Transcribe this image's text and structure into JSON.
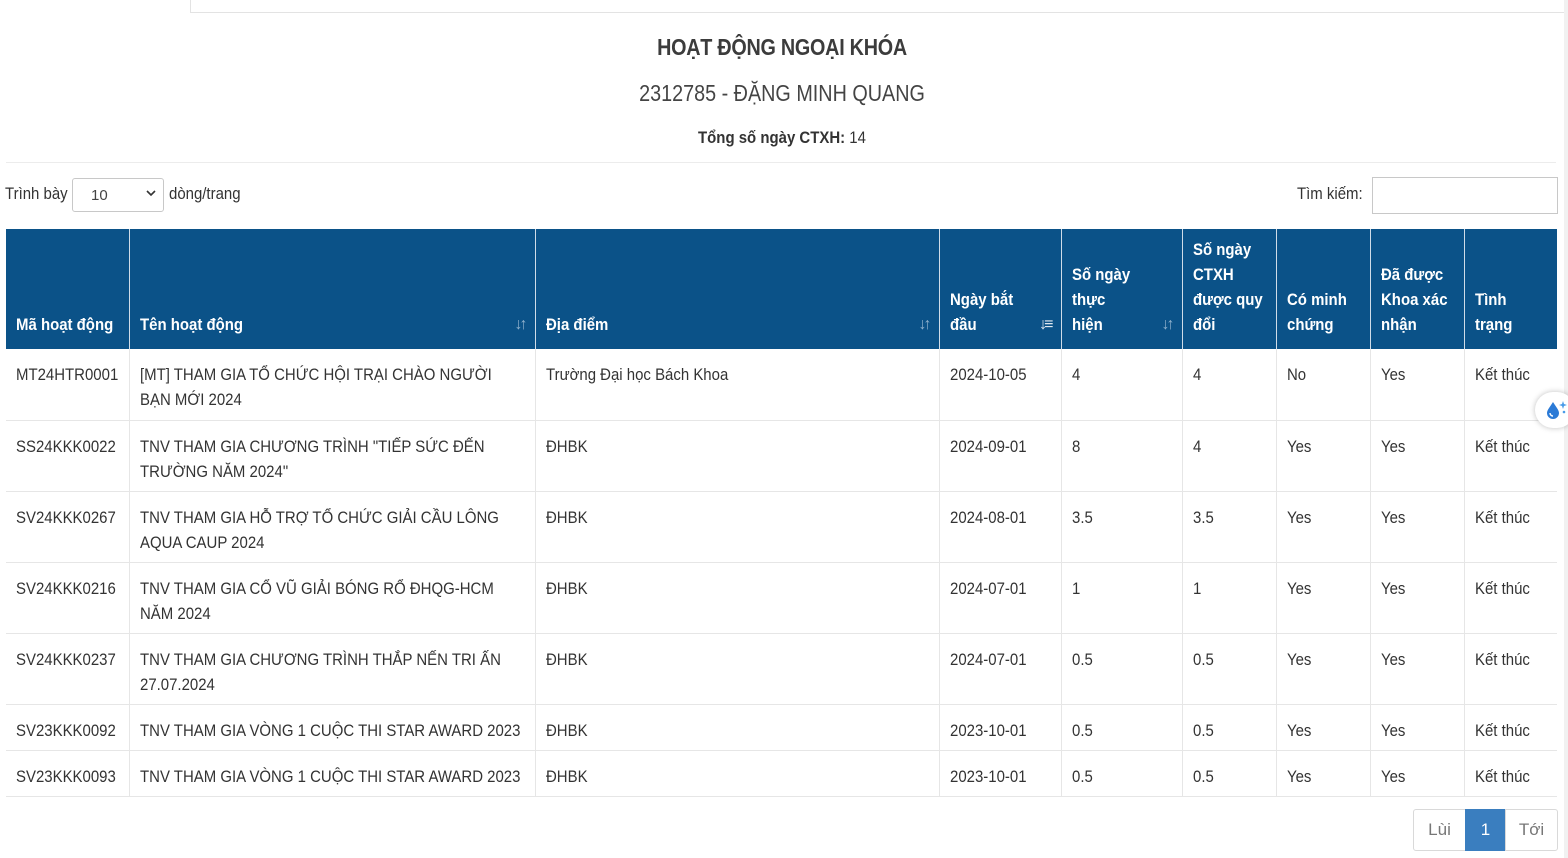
{
  "page": {
    "title": "HOẠT ĐỘNG NGOẠI KHÓA",
    "student": "2312785 - ĐẶNG MINH QUANG",
    "total_label": "Tổng số ngày CTXH:",
    "total_value": "14"
  },
  "controls": {
    "show_label": "Trình bày",
    "page_length": "10",
    "rows_label": "dòng/trang",
    "search_label": "Tìm kiếm:",
    "search_value": ""
  },
  "table": {
    "headers": [
      "Mã hoạt động",
      "Tên hoạt động",
      "Địa điểm",
      "Ngày bắt đầu",
      "Số ngày thực hiện",
      "Số ngày CTXH được quy đổi",
      "Có minh chứng",
      "Đã được Khoa xác nhận",
      "Tình trạng"
    ],
    "rows": [
      [
        "MT24HTR0001",
        "[MT] THAM GIA TỔ CHỨC HỘI TRẠI CHÀO NGƯỜI BẠN MỚI 2024",
        "Trường Đại học Bách Khoa",
        "2024-10-05",
        "4",
        "4",
        "No",
        "Yes",
        "Kết thúc"
      ],
      [
        "SS24KKK0022",
        "TNV THAM GIA CHƯƠNG TRÌNH \"TIẾP SỨC ĐẾN TRƯỜNG NĂM 2024\"",
        "ĐHBK",
        "2024-09-01",
        "8",
        "4",
        "Yes",
        "Yes",
        "Kết thúc"
      ],
      [
        "SV24KKK0267",
        "TNV THAM GIA HỖ TRỢ TỔ CHỨC GIẢI CẦU LÔNG AQUA CAUP 2024",
        "ĐHBK",
        "2024-08-01",
        "3.5",
        "3.5",
        "Yes",
        "Yes",
        "Kết thúc"
      ],
      [
        "SV24KKK0216",
        "TNV THAM GIA CỔ VŨ GIẢI BÓNG RỔ ĐHQG-HCM NĂM 2024",
        "ĐHBK",
        "2024-07-01",
        "1",
        "1",
        "Yes",
        "Yes",
        "Kết thúc"
      ],
      [
        "SV24KKK0237",
        "TNV THAM GIA CHƯƠNG TRÌNH THẮP NẾN TRI ẤN 27.07.2024",
        "ĐHBK",
        "2024-07-01",
        "0.5",
        "0.5",
        "Yes",
        "Yes",
        "Kết thúc"
      ],
      [
        "SV23KKK0092",
        "TNV THAM GIA VÒNG 1 CUỘC THI STAR AWARD 2023",
        "ĐHBK",
        "2023-10-01",
        "0.5",
        "0.5",
        "Yes",
        "Yes",
        "Kết thúc"
      ],
      [
        "SV23KKK0093",
        "TNV THAM GIA VÒNG 1 CUỘC THI STAR AWARD 2023",
        "ĐHBK",
        "2023-10-01",
        "0.5",
        "0.5",
        "Yes",
        "Yes",
        "Kết thúc"
      ]
    ]
  },
  "pagination": {
    "prev": "Lùi",
    "current": "1",
    "next": "Tới"
  },
  "colors": {
    "header_bg": "#0b5288",
    "active_page": "#3a7ebf"
  }
}
